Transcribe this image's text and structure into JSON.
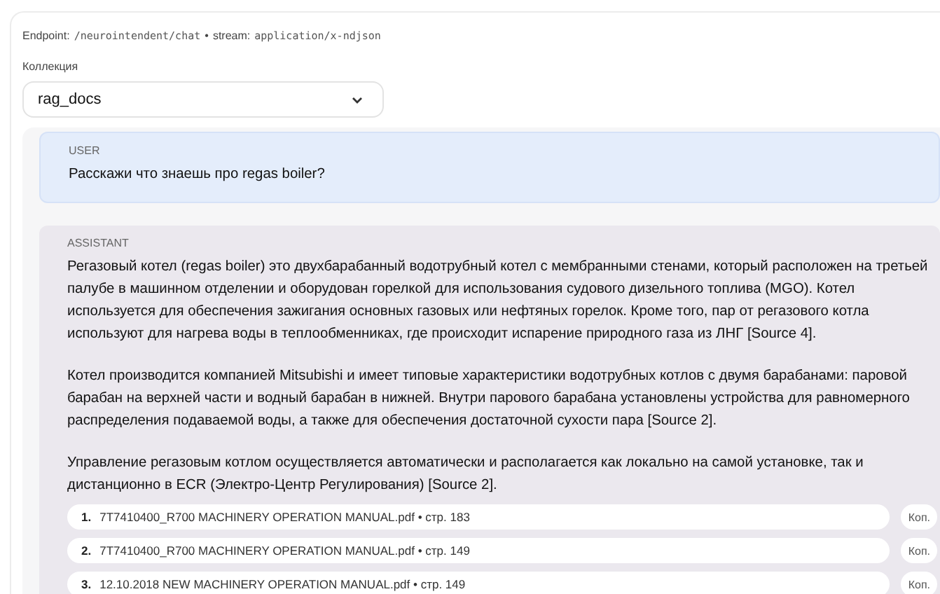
{
  "endpoint": {
    "label": "Endpoint:",
    "path": "/neurointendent/chat",
    "separator": "•",
    "stream_label": "stream:",
    "stream_type": "application/x-ndjson"
  },
  "collection": {
    "label": "Коллекция",
    "value": "rag_docs"
  },
  "messages": [
    {
      "role": "USER",
      "kind": "user",
      "paragraphs": [
        "Расскажи что знаешь про regas boiler?"
      ]
    },
    {
      "role": "ASSISTANT",
      "kind": "assistant",
      "paragraphs": [
        "Регазовый котел (regas boiler) это двухбарабанный водотрубный котел с мембранными стенами, который расположен на третьей палубе в машинном отделении и оборудован горелкой для использования судового дизельного топлива (MGO). Котел используется для обеспечения зажигания основных газовых или нефтяных горелок. Кроме того, пар от регазового котла используют для нагрева воды в теплообменниках, где происходит испарение природного газа из ЛНГ [Source 4].",
        "Котел производится компанией Mitsubishi и имеет типовые характеристики водотрубных котлов с двумя барабанами: паровой барабан на верхней части и водный барабан в нижней. Внутри парового барабана установлены устройства для равномерного распределения подаваемой воды, а также для обеспечения достаточной сухости пара [Source 2].",
        "Управление регазовым котлом осуществляется автоматически и располагается как локально на самой установке, так и дистанционно в ECR (Электро-Центр Регулирования) [Source 2]."
      ],
      "sources": [
        {
          "number": "1.",
          "text": "7T7410400_R700 MACHINERY OPERATION MANUAL.pdf • стр. 183",
          "button": "Коп."
        },
        {
          "number": "2.",
          "text": "7T7410400_R700 MACHINERY OPERATION MANUAL.pdf • стр. 149",
          "button": "Коп."
        },
        {
          "number": "3.",
          "text": "12.10.2018 NEW MACHINERY OPERATION MANUAL.pdf • стр. 149",
          "button": "Коп."
        }
      ]
    }
  ]
}
